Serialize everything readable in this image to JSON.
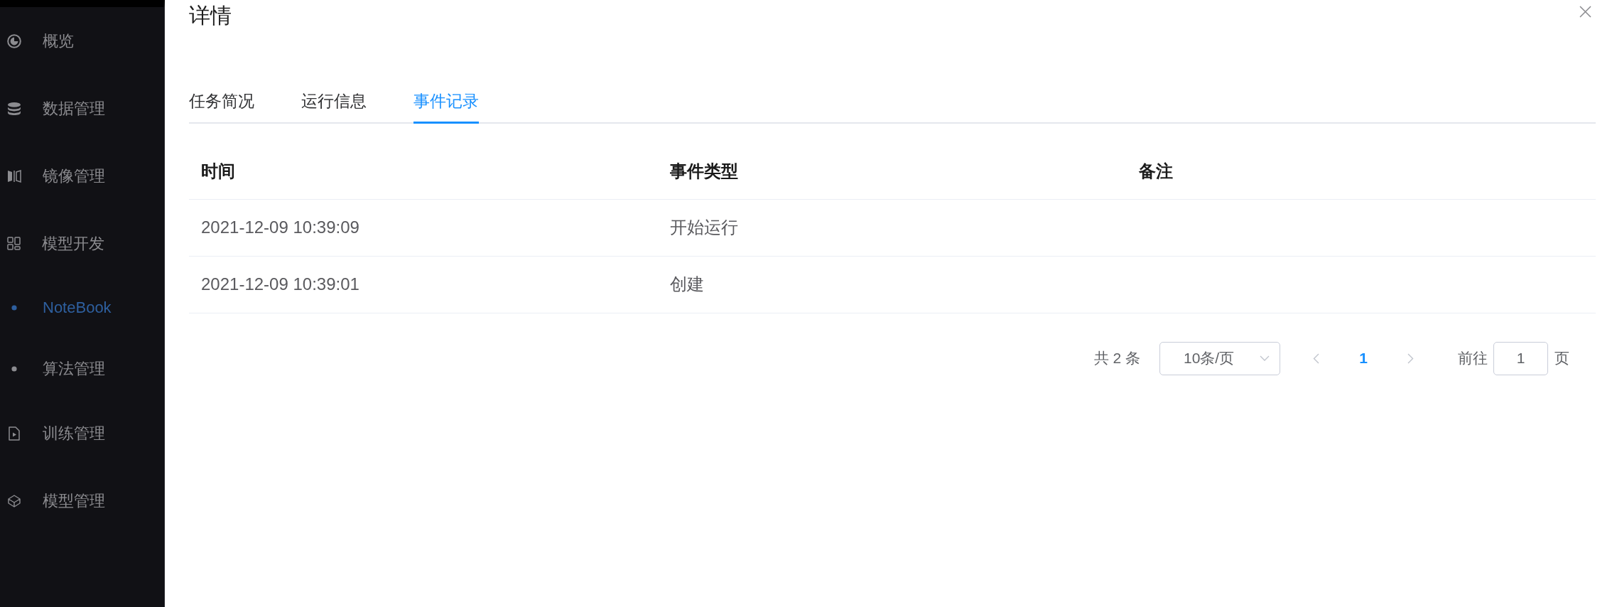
{
  "window": {
    "title": "详情"
  },
  "sidebar": {
    "items": [
      {
        "label": "概览",
        "selected": false
      },
      {
        "label": "数据管理",
        "selected": false
      },
      {
        "label": "镜像管理",
        "selected": false
      },
      {
        "label": "模型开发",
        "selected": false,
        "children": [
          {
            "label": "NoteBook",
            "selected": true
          },
          {
            "label": "算法管理",
            "selected": false
          }
        ]
      },
      {
        "label": "训练管理",
        "selected": false
      },
      {
        "label": "模型管理",
        "selected": false
      }
    ]
  },
  "tabs": [
    {
      "label": "任务简况",
      "selected": false
    },
    {
      "label": "运行信息",
      "selected": false
    },
    {
      "label": "事件记录",
      "selected": true
    }
  ],
  "table": {
    "columns": [
      "时间",
      "事件类型",
      "备注"
    ],
    "rows": [
      [
        "2021-12-09 10:39:09",
        "开始运行"
      ],
      [
        "2021-12-09 10:39:01",
        "创建"
      ]
    ]
  },
  "pagination": {
    "total": "共 2 条",
    "page_size": "10条/页",
    "prev": {
      "disabled": true
    },
    "pages": [
      {
        "label": "1",
        "selected": true
      }
    ],
    "next": {
      "disabled": true
    },
    "goto_label": "前往",
    "goto_value": "1",
    "goto_suffix": "页"
  }
}
